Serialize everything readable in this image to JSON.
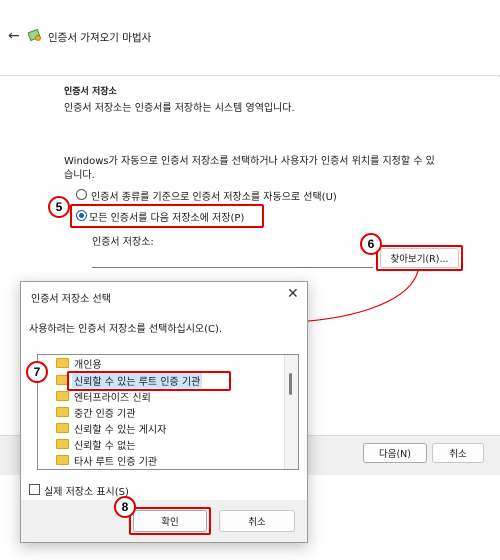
{
  "wizard": {
    "title": "인증서 가져오기 마법사",
    "section_title": "인증서 저장소",
    "section_desc": "인증서 저장소는 인증서를 저장하는 시스템 영역입니다.",
    "desc_line1": "Windows가 자동으로 인증서 저장소를 선택하거나 사용자가 인증서 위치를 지정할 수 있",
    "desc_line2": "습니다.",
    "option_auto": "인증서 종류를 기준으로 인증서 저장소를 자동으로 선택(U)",
    "option_manual": "모든 인증서를 다음 저장소에 저장(P)",
    "store_label": "인증서 저장소:",
    "store_value": "",
    "browse_button": "찾아보기(R)...",
    "next_button": "다음(N)",
    "cancel_button": "취소"
  },
  "dialog": {
    "title": "인증서 저장소 선택",
    "close_symbol": "✕",
    "prompt": "사용하려는 인증서 저장소를 선택하십시오(C).",
    "stores": [
      "개인용",
      "신뢰할 수 있는 루트 인증 기관",
      "엔터프라이즈 신뢰",
      "중간 인증 기관",
      "신뢰할 수 있는 게시자",
      "신뢰할 수 없는",
      "타사 루트 인증 기관"
    ],
    "selected_index": 1,
    "show_physical": "실제 저장소 표시(S)",
    "ok_button": "확인",
    "cancel_button": "취소"
  },
  "callouts": [
    "5",
    "6",
    "7",
    "8"
  ],
  "colors": {
    "highlight": "#e00000",
    "selection": "#cfe3fb",
    "folder": "#f3c94c"
  }
}
